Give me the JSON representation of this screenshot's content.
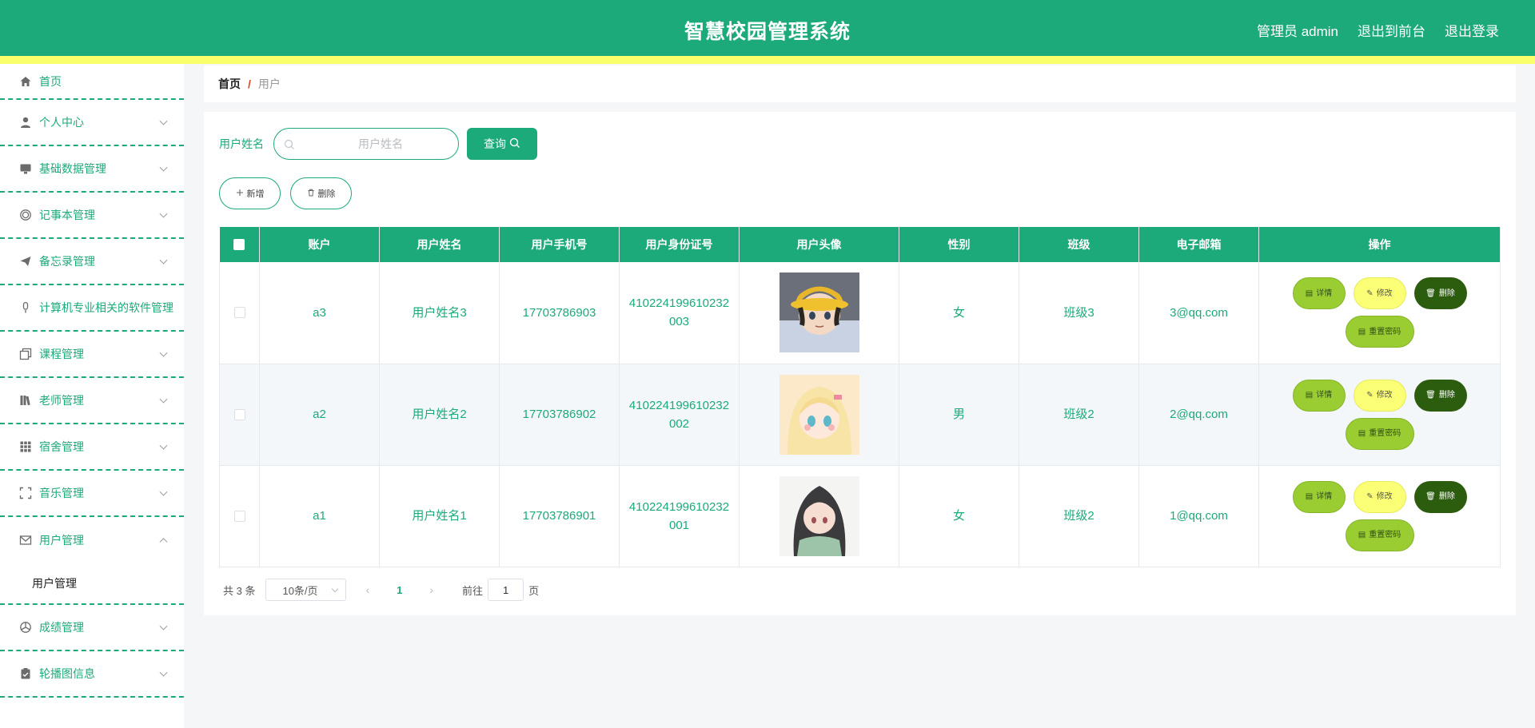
{
  "header": {
    "title": "智慧校园管理系统",
    "admin_label": "管理员 admin",
    "front_label": "退出到前台",
    "logout_label": "退出登录"
  },
  "colors": {
    "primary": "#1caa7a",
    "accent_yellow": "#f9ff6a",
    "detail_button": "#9acd32",
    "edit_button": "#fbff75",
    "delete_button": "#2c5d0e"
  },
  "sidebar": {
    "items": [
      {
        "label": "首页",
        "icon": "home-icon"
      },
      {
        "label": "个人中心",
        "icon": "user-icon"
      },
      {
        "label": "基础数据管理",
        "icon": "monitor-icon"
      },
      {
        "label": "记事本管理",
        "icon": "circle-icon"
      },
      {
        "label": "备忘录管理",
        "icon": "send-icon"
      },
      {
        "label": "计算机专业相关的软件管理",
        "icon": "microphone-icon"
      },
      {
        "label": "课程管理",
        "icon": "copy-icon"
      },
      {
        "label": "老师管理",
        "icon": "books-icon"
      },
      {
        "label": "宿舍管理",
        "icon": "grid-icon"
      },
      {
        "label": "音乐管理",
        "icon": "fullscreen-icon"
      },
      {
        "label": "用户管理",
        "icon": "mail-icon"
      },
      {
        "label": "成绩管理",
        "icon": "aperture-icon"
      },
      {
        "label": "轮播图信息",
        "icon": "clipboard-icon"
      }
    ],
    "submenu_label": "用户管理"
  },
  "breadcrumb": {
    "home": "首页",
    "separator": "/",
    "current": "用户"
  },
  "search": {
    "label": "用户姓名",
    "placeholder": "用户姓名",
    "button_label": "查询"
  },
  "actions": {
    "add_label": "新增",
    "delete_label": "删除"
  },
  "table": {
    "headers": [
      "账户",
      "用户姓名",
      "用户手机号",
      "用户身份证号",
      "用户头像",
      "性别",
      "班级",
      "电子邮箱",
      "操作"
    ],
    "rows": [
      {
        "account": "a3",
        "name": "用户姓名3",
        "phone": "17703786903",
        "id_card_1": "410224199610232",
        "id_card_2": "003",
        "avatar": "anime-boy-yellow-hat",
        "gender": "女",
        "class": "班级3",
        "email": "3@qq.com"
      },
      {
        "account": "a2",
        "name": "用户姓名2",
        "phone": "17703786902",
        "id_card_1": "410224199610232",
        "id_card_2": "002",
        "avatar": "anime-girl-blonde",
        "gender": "男",
        "class": "班级2",
        "email": "2@qq.com"
      },
      {
        "account": "a1",
        "name": "用户姓名1",
        "phone": "17703786901",
        "id_card_1": "410224199610232",
        "id_card_2": "001",
        "avatar": "anime-girl-dark-hair",
        "gender": "女",
        "class": "班级2",
        "email": "1@qq.com"
      }
    ],
    "op_labels": {
      "detail": "详情",
      "edit": "修改",
      "delete": "删除",
      "reset": "重置密码"
    }
  },
  "pagination": {
    "total": "共 3 条",
    "page_size": "10条/页",
    "current_page": "1",
    "goto_prefix": "前往",
    "goto_value": "1",
    "goto_suffix": "页"
  }
}
